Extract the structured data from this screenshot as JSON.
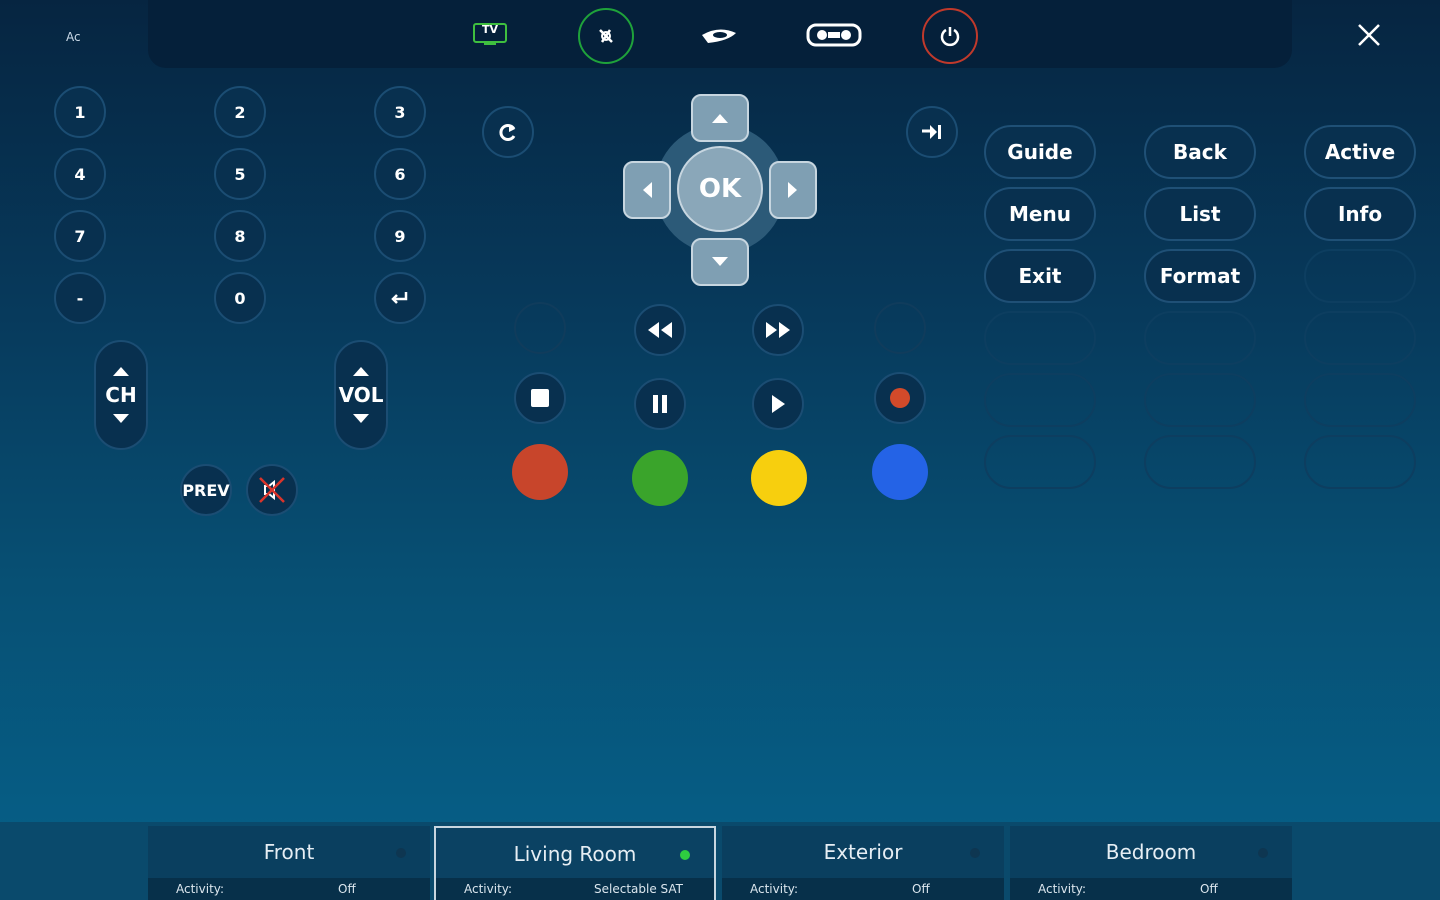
{
  "top_bar": {
    "corner_label": "Ac",
    "icons": [
      "tv-icon",
      "mute-satellite-icon",
      "bluray-icon",
      "vcr-icon",
      "power-icon"
    ],
    "tv_label": "TV"
  },
  "numpad": {
    "keys": [
      "1",
      "2",
      "3",
      "4",
      "5",
      "6",
      "7",
      "8",
      "9",
      "-",
      "0"
    ]
  },
  "channel": {
    "label": "CH"
  },
  "volume": {
    "label": "VOL"
  },
  "prev": {
    "label": "PREV"
  },
  "dpad": {
    "ok_label": "OK"
  },
  "menu_buttons": {
    "guide": "Guide",
    "back": "Back",
    "active": "Active",
    "menu": "Menu",
    "list": "List",
    "info": "Info",
    "exit": "Exit",
    "format": "Format"
  },
  "colors": {
    "red": "#c8452b",
    "green": "#3aa42b",
    "yellow": "#f7cf0e",
    "blue": "#2463e6",
    "record": "#d24a2a"
  },
  "rooms": [
    {
      "name": "Front",
      "activity_label": "Activity:",
      "activity": "Off",
      "active": false
    },
    {
      "name": "Living Room",
      "activity_label": "Activity:",
      "activity": "Selectable SAT",
      "active": true
    },
    {
      "name": "Exterior",
      "activity_label": "Activity:",
      "activity": "Off",
      "active": false
    },
    {
      "name": "Bedroom",
      "activity_label": "Activity:",
      "activity": "Off",
      "active": false
    }
  ]
}
